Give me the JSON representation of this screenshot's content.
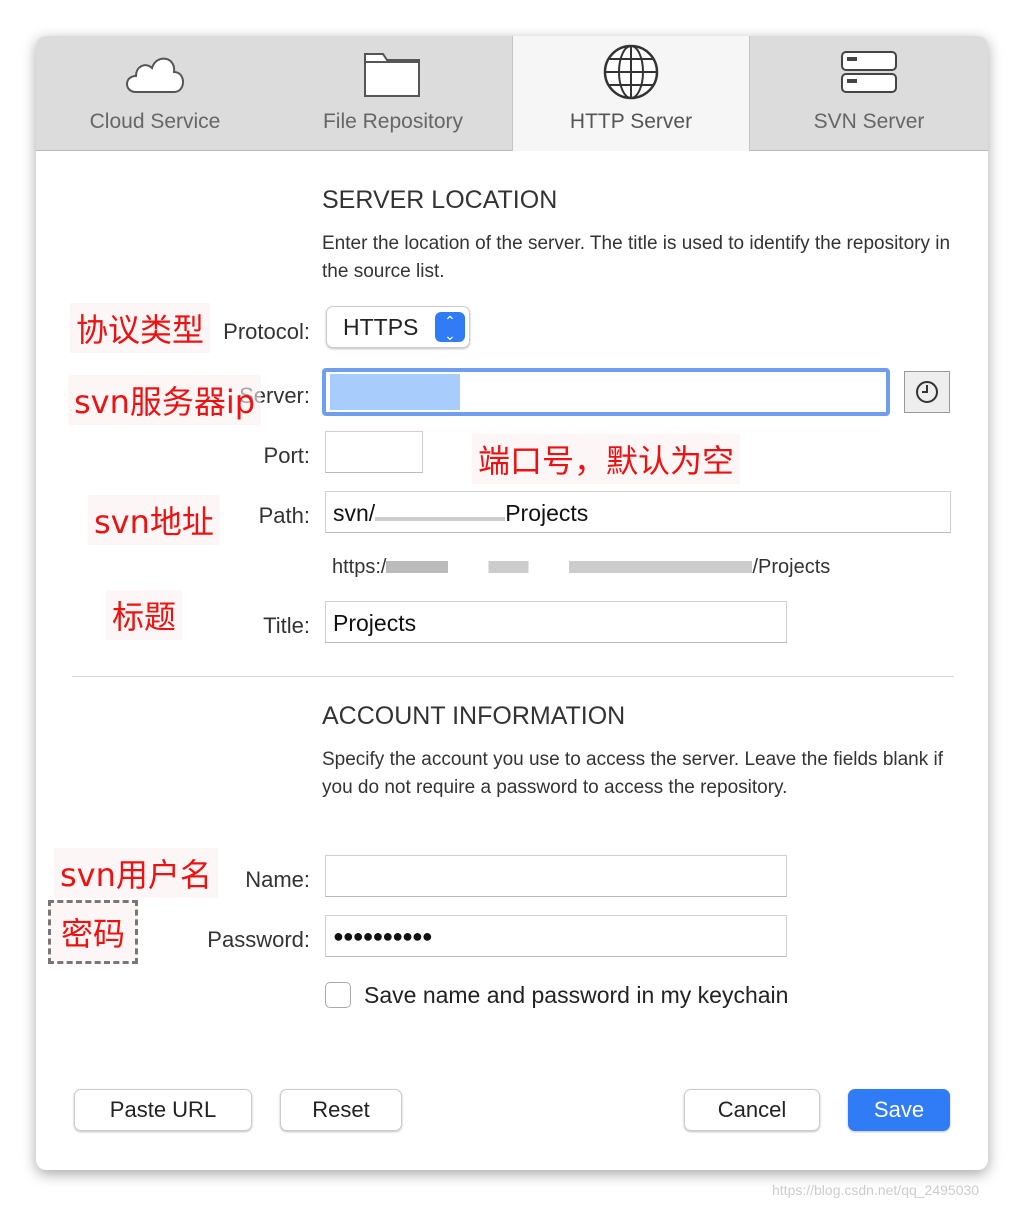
{
  "tabs": [
    {
      "label": "Cloud Service",
      "icon": "cloud-icon"
    },
    {
      "label": "File Repository",
      "icon": "folder-icon"
    },
    {
      "label": "HTTP Server",
      "icon": "globe-icon",
      "active": true
    },
    {
      "label": "SVN Server",
      "icon": "server-icon"
    }
  ],
  "server_location": {
    "heading": "SERVER LOCATION",
    "description": "Enter the location of the server. The title is used to identify the repository in the source list.",
    "protocol_label": "Protocol:",
    "protocol_value": "HTTPS",
    "server_label": "Server:",
    "server_value": "",
    "port_label": "Port:",
    "port_value": "",
    "path_label": "Path:",
    "path_prefix": "svn/",
    "path_suffix": "Projects",
    "url_prefix": "https:/",
    "url_suffix": "/Projects",
    "title_label": "Title:",
    "title_value": "Projects"
  },
  "account": {
    "heading": "ACCOUNT INFORMATION",
    "description": "Specify the account you use to access the server. Leave the fields blank if you do not require a password to access the repository.",
    "name_label": "Name:",
    "name_value": "",
    "password_label": "Password:",
    "password_value": "●●●●●●●●●●",
    "keychain_label": "Save name and password in my keychain",
    "keychain_checked": false
  },
  "buttons": {
    "paste_url": "Paste URL",
    "reset": "Reset",
    "cancel": "Cancel",
    "save": "Save"
  },
  "annotations": {
    "protocol": "协议类型",
    "server": "svn服务器ip",
    "port": "端口号，默认为空",
    "path": "svn地址",
    "title": "标题",
    "name": "svn用户名",
    "password": "密码"
  },
  "watermark": "https://blog.csdn.net/qq_2495030",
  "colors": {
    "accent": "#2f7cf6",
    "annotation": "#ee1111",
    "focus": "#6f9ef0"
  }
}
